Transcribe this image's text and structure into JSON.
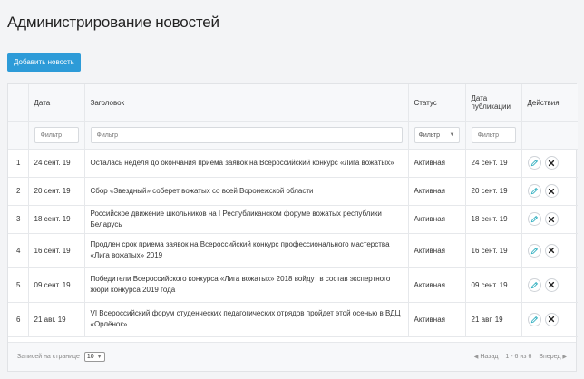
{
  "page": {
    "title": "Администрирование новостей"
  },
  "toolbar": {
    "add_label": "Добавить новость"
  },
  "table": {
    "columns": {
      "date": "Дата",
      "title": "Заголовок",
      "status": "Статус",
      "pub_date": "Дата публикации",
      "actions": "Действия"
    },
    "filters": {
      "date_placeholder": "Фильтр",
      "title_placeholder": "Фильтр",
      "status_value": "Фильтр",
      "pub_placeholder": "Фильтр"
    },
    "rows": [
      {
        "num": "1",
        "date": "24 сент. 19",
        "title": "Осталась неделя до окончания приема заявок на Всероссийский конкурс «Лига вожатых»",
        "status": "Активная",
        "pub_date": "24 сент. 19"
      },
      {
        "num": "2",
        "date": "20 сент. 19",
        "title": "Сбор «Звездный» соберет вожатых со всей Воронежской области",
        "status": "Активная",
        "pub_date": "20 сент. 19"
      },
      {
        "num": "3",
        "date": "18 сент. 19",
        "title": "Российское движение школьников на I Республиканском форуме вожатых республики Беларусь",
        "status": "Активная",
        "pub_date": "18 сент. 19"
      },
      {
        "num": "4",
        "date": "16 сент. 19",
        "title": "Продлен срок приема заявок на Всероссийский конкурс профессионального мастерства «Лига вожатых» 2019",
        "status": "Активная",
        "pub_date": "16 сент. 19"
      },
      {
        "num": "5",
        "date": "09 сент. 19",
        "title": "Победители Всероссийского конкурса «Лига вожатых» 2018 войдут в состав экспертного жюри конкурса 2019 года",
        "status": "Активная",
        "pub_date": "09 сент. 19"
      },
      {
        "num": "6",
        "date": "21 авг. 19",
        "title": "VI Всероссийский форум студенческих педагогических отрядов пройдет этой осенью в ВДЦ «Орлёнок»",
        "status": "Активная",
        "pub_date": "21 авг. 19"
      }
    ]
  },
  "footer": {
    "per_page_label": "Записей на странице",
    "per_page_value": "10",
    "prev_label": "Назад",
    "range": "1 - 6 из 6",
    "next_label": "Вперед"
  },
  "icons": {
    "edit": "pencil-icon",
    "delete": "close-icon",
    "chevron": "chevron-down-icon"
  },
  "colors": {
    "accent": "#2d9bd8",
    "edit_icon": "#3bb3c3",
    "delete_icon": "#222222"
  }
}
